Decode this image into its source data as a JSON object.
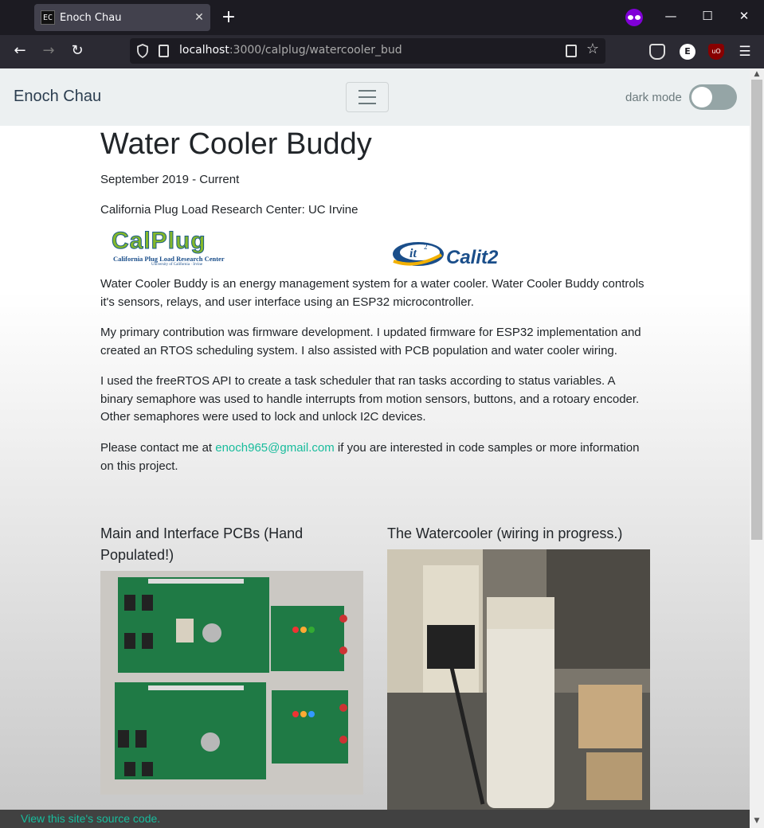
{
  "browser": {
    "tab_title": "Enoch Chau",
    "tab_favicon": "EC",
    "url_host": "localhost",
    "url_rest": ":3000/calplug/watercooler_bud",
    "icons": {
      "back": "arrow-left-icon",
      "forward": "arrow-right-icon",
      "reload": "reload-icon",
      "bookmark": "star-icon",
      "menu": "hamburger-menu-icon"
    }
  },
  "site": {
    "brand": "Enoch Chau",
    "dark_mode_label": "dark mode",
    "dark_mode_on": false
  },
  "page": {
    "title": "Water Cooler Buddy",
    "date_range": "September 2019 - Current",
    "organization": "California Plug Load Research Center: UC Irvine",
    "logo_calplug": {
      "word": "CalPlug",
      "subtitle": "California Plug Load Research Center",
      "subtitle2": "University of California · Irvine"
    },
    "logo_calit2": {
      "badge": "it",
      "badge_sup": "2",
      "word": "Calit2"
    },
    "para1": "Water Cooler Buddy is an energy management system for a water cooler. Water Cooler Buddy controls it's sensors, relays, and user interface using an ESP32 microcontroller.",
    "para2": "My primary contribution was firmware development. I updated firmware for ESP32 implementation and created an RTOS scheduling system. I also assisted with PCB population and water cooler wiring.",
    "para3": "I used the freeRTOS API to create a task scheduler that ran tasks according to status variables. A binary semaphore was used to handle interrupts from motion sensors, buttons, and a rotoary encoder. Other semaphores were used to lock and unlock I2C devices.",
    "contact_before": "Please contact me at ",
    "contact_email": "enoch965@gmail.com",
    "contact_after": " if you are interested in code samples or more information on this project.",
    "figure1_caption": "Main and Interface PCBs (Hand Populated!)",
    "figure2_caption": "The Watercooler (wiring in progress.)"
  },
  "footer": {
    "source_link": "View this site's source code."
  },
  "colors": {
    "accent": "#18bc9c",
    "navbar_bg": "#ecf0f1",
    "brand_text": "#2c3e50"
  }
}
